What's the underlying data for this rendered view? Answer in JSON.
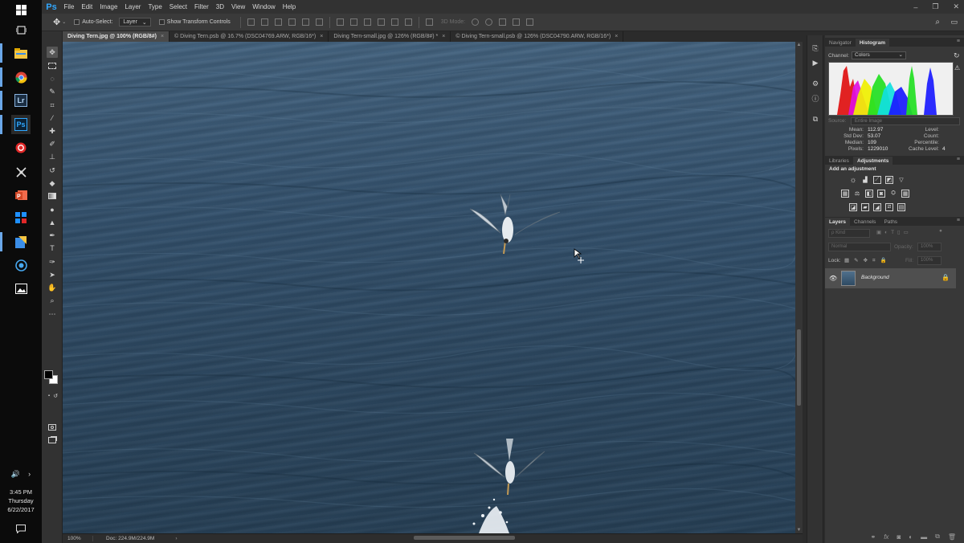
{
  "taskbar": {
    "icons": [
      "windows-logo-icon",
      "task-view-icon",
      "file-explorer-icon",
      "chrome-icon",
      "lightroom-icon",
      "photoshop-icon",
      "red-circle-app-icon",
      "tool-app-icon",
      "powerpoint-icon",
      "color-app-icon",
      "edge-like-icon",
      "globe-app-icon",
      "photos-icon"
    ],
    "lr_label": "Lr",
    "ps_label": "Ps",
    "tray": {
      "volume": "🔊",
      "chevron": "›"
    },
    "clock": {
      "time": "3:45 PM",
      "day": "Thursday",
      "date": "6/22/2017"
    }
  },
  "app": {
    "logo": "Ps",
    "menu": [
      "File",
      "Edit",
      "Image",
      "Layer",
      "Type",
      "Select",
      "Filter",
      "3D",
      "View",
      "Window",
      "Help"
    ],
    "window_controls": {
      "minimize": "–",
      "restore": "❐",
      "close": "✕"
    }
  },
  "options_bar": {
    "auto_select_label": "Auto-Select:",
    "auto_select_value": "Layer",
    "transform_label": "Show Transform Controls",
    "mode_3d_label": "3D Mode:"
  },
  "tabs": [
    {
      "label": "Diving Tern.jpg @ 100% (RGB/8#)",
      "active": true
    },
    {
      "label": "© Diving Tern.psb @ 16.7% (DSC04769.ARW, RGB/16*)",
      "active": false
    },
    {
      "label": "Diving Tern-small.jpg @ 126% (RGB/8#) *",
      "active": false
    },
    {
      "label": "© Diving Tern-small.psb @ 126% (DSC04790.ARW, RGB/16*)",
      "active": false
    }
  ],
  "tab_close": "×",
  "status": {
    "zoom": "100%",
    "doc": "Doc: 224.9M/224.9M",
    "chevron": "›"
  },
  "histogram": {
    "tabs": [
      "Navigator",
      "Histogram"
    ],
    "active_tab": "Histogram",
    "channel_label": "Channel:",
    "channel_value": "Colors",
    "source_label": "Source:",
    "source_value": "Entire Image",
    "stats": {
      "mean_label": "Mean:",
      "mean": "112.97",
      "stddev_label": "Std Dev:",
      "stddev": "53.07",
      "median_label": "Median:",
      "median": "109",
      "pixels_label": "Pixels:",
      "pixels": "1229010",
      "level_label": "Level:",
      "count_label": "Count:",
      "percentile_label": "Percentile:",
      "cache_label": "Cache Level:",
      "cache": "4"
    },
    "colors": {
      "red": "#e01010",
      "green": "#22e022",
      "blue": "#1a1aff",
      "yellow": "#f0f000",
      "magenta": "#e010e0",
      "cyan": "#10e0e0",
      "white": "#f0f0f0"
    }
  },
  "adjustments": {
    "tabs": [
      "Libraries",
      "Adjustments"
    ],
    "active_tab": "Adjustments",
    "heading": "Add an adjustment"
  },
  "layers": {
    "tabs": [
      "Layers",
      "Channels",
      "Paths"
    ],
    "active_tab": "Layers",
    "kind_placeholder": "ρ Kind",
    "blend_mode": "Normal",
    "opacity_label": "Opacity:",
    "opacity_value": "100%",
    "lock_label": "Lock:",
    "fill_label": "Fill:",
    "fill_value": "100%",
    "layer_name": "Background"
  }
}
